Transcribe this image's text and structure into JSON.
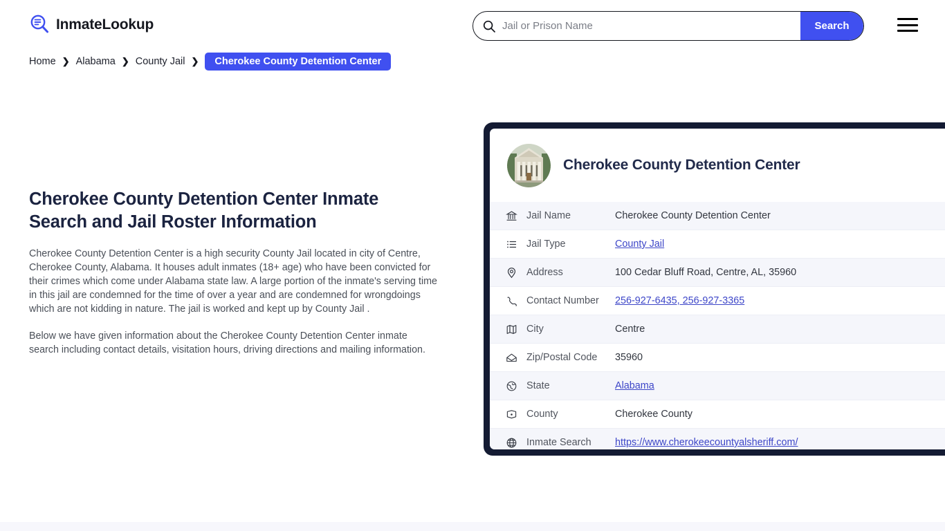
{
  "header": {
    "brand_name": "InmateLookup",
    "brand_logo_icon": "magnifier-list-icon",
    "search": {
      "placeholder": "Jail or Prison Name",
      "value": "",
      "icon": "search-icon",
      "button_label": "Search"
    },
    "menu_icon": "hamburger-menu-icon"
  },
  "breadcrumb": {
    "items": [
      {
        "label": "Home",
        "current": false
      },
      {
        "label": "Alabama",
        "current": false
      },
      {
        "label": "County Jail",
        "current": false
      },
      {
        "label": "Cherokee County Detention Center",
        "current": true
      }
    ],
    "separator_icon": "chevron-right-icon"
  },
  "main": {
    "title": "Cherokee County Detention Center Inmate Search and Jail Roster Information",
    "paragraphs": [
      "Cherokee County Detention Center is a high security County Jail located in city of Centre, Cherokee County, Alabama. It houses adult inmates (18+ age) who have been convicted for their crimes which come under Alabama state law. A large portion of the inmate's serving time in this jail are condemned for the time of over a year and are condemned for wrongdoings which are not kidding in nature. The jail is worked and kept up by County Jail .",
      "Below we have given information about the Cherokee County Detention Center inmate search including contact details, visitation hours, driving directions and mailing information."
    ]
  },
  "card": {
    "avatar_icon": "courthouse-photo",
    "title": "Cherokee County Detention Center",
    "rows": [
      {
        "icon": "bank-icon",
        "label": "Jail Name",
        "value": "Cherokee County Detention Center",
        "link": false
      },
      {
        "icon": "list-icon",
        "label": "Jail Type",
        "value": "County Jail",
        "link": true
      },
      {
        "icon": "map-pin-icon",
        "label": "Address",
        "value": "100 Cedar Bluff Road, Centre, AL, 35960",
        "link": false
      },
      {
        "icon": "phone-icon",
        "label": "Contact Number",
        "value": "256-927-6435, 256-927-3365",
        "link": true
      },
      {
        "icon": "map-icon",
        "label": "City",
        "value": "Centre",
        "link": false
      },
      {
        "icon": "envelope-icon",
        "label": "Zip/Postal Code",
        "value": "35960",
        "link": false
      },
      {
        "icon": "globe-state-icon",
        "label": "State",
        "value": "Alabama",
        "link": true
      },
      {
        "icon": "county-map-icon",
        "label": "County",
        "value": "Cherokee County",
        "link": false
      },
      {
        "icon": "web-globe-icon",
        "label": "Inmate Search",
        "value": "https://www.cherokeecountyalsheriff.com/",
        "link": true
      }
    ]
  },
  "colors": {
    "accent": "#4050f0",
    "card_border": "#141b33",
    "link": "#3d46c8",
    "title": "#1b2340",
    "row_alt": "#f5f6fb",
    "footer_strip": "#f7f7fc"
  }
}
